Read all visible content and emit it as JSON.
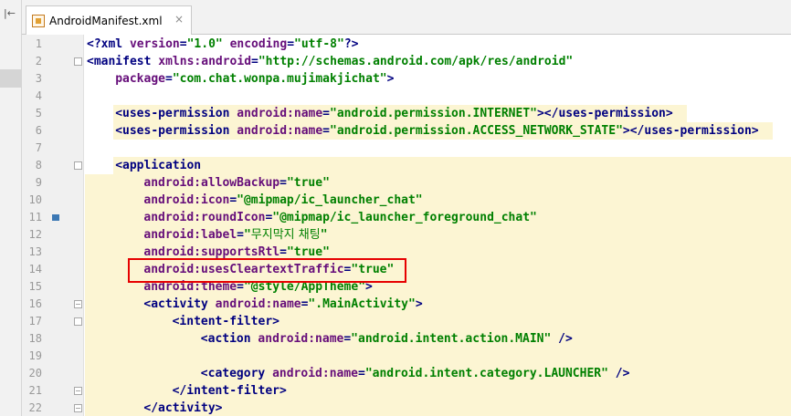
{
  "tab": {
    "label": "AndroidManifest.xml",
    "close": "×"
  },
  "sidebar": {
    "collapse_glyph": "|←"
  },
  "lines": [
    {
      "n": "1",
      "indent": 0,
      "parts": [
        [
          "t",
          "<?xml "
        ],
        [
          "a",
          "version"
        ],
        [
          "t",
          "="
        ],
        [
          "v",
          "\"1.0\""
        ],
        [
          "t",
          " "
        ],
        [
          "a",
          "encoding"
        ],
        [
          "t",
          "="
        ],
        [
          "v",
          "\"utf-8\""
        ],
        [
          "t",
          "?>"
        ]
      ]
    },
    {
      "n": "2",
      "indent": 0,
      "parts": [
        [
          "t",
          "<manifest "
        ],
        [
          "a",
          "xmlns:android"
        ],
        [
          "t",
          "="
        ],
        [
          "v",
          "\"http://schemas.android.com/apk/res/android\""
        ]
      ]
    },
    {
      "n": "3",
      "indent": 1,
      "parts": [
        [
          "a",
          "package"
        ],
        [
          "t",
          "="
        ],
        [
          "v",
          "\"com.chat.wonpa.mujimakjichat\""
        ],
        [
          "t",
          ">"
        ]
      ]
    },
    {
      "n": "4",
      "indent": 0,
      "parts": []
    },
    {
      "n": "5",
      "indent": 1,
      "parts": [
        [
          "t",
          "<uses-permission "
        ],
        [
          "a",
          "android:name"
        ],
        [
          "t",
          "="
        ],
        [
          "v",
          "\"android.permission.INTERNET\""
        ],
        [
          "t",
          "></uses-permission>"
        ]
      ]
    },
    {
      "n": "6",
      "indent": 1,
      "parts": [
        [
          "t",
          "<uses-permission "
        ],
        [
          "a",
          "android:name"
        ],
        [
          "t",
          "="
        ],
        [
          "v",
          "\"android.permission.ACCESS_NETWORK_STATE\""
        ],
        [
          "t",
          "></uses-permission>"
        ]
      ]
    },
    {
      "n": "7",
      "indent": 0,
      "parts": []
    },
    {
      "n": "8",
      "indent": 1,
      "parts": [
        [
          "t",
          "<application"
        ]
      ]
    },
    {
      "n": "9",
      "indent": 2,
      "parts": [
        [
          "a",
          "android:allowBackup"
        ],
        [
          "t",
          "="
        ],
        [
          "v",
          "\"true\""
        ]
      ]
    },
    {
      "n": "10",
      "indent": 2,
      "parts": [
        [
          "a",
          "android:icon"
        ],
        [
          "t",
          "="
        ],
        [
          "v",
          "\"@mipmap/ic_launcher_chat\""
        ]
      ]
    },
    {
      "n": "11",
      "indent": 2,
      "parts": [
        [
          "a",
          "android:roundIcon"
        ],
        [
          "t",
          "="
        ],
        [
          "v",
          "\"@mipmap/ic_launcher_foreground_chat\""
        ]
      ]
    },
    {
      "n": "12",
      "indent": 2,
      "parts": [
        [
          "a",
          "android:label"
        ],
        [
          "t",
          "="
        ],
        [
          "v",
          "\""
        ],
        [
          "kr",
          "무지막지 채팅"
        ],
        [
          "v",
          "\""
        ]
      ]
    },
    {
      "n": "13",
      "indent": 2,
      "parts": [
        [
          "a",
          "android:supportsRtl"
        ],
        [
          "t",
          "="
        ],
        [
          "v",
          "\"true\""
        ]
      ]
    },
    {
      "n": "14",
      "indent": 2,
      "parts": [
        [
          "a",
          "android:usesCleartextTraffic"
        ],
        [
          "t",
          "="
        ],
        [
          "v",
          "\"true\""
        ]
      ]
    },
    {
      "n": "15",
      "indent": 2,
      "parts": [
        [
          "a",
          "android:theme"
        ],
        [
          "t",
          "="
        ],
        [
          "v",
          "\"@style/AppTheme\""
        ],
        [
          "t",
          ">"
        ]
      ]
    },
    {
      "n": "16",
      "indent": 2,
      "parts": [
        [
          "t",
          "<activity "
        ],
        [
          "a",
          "android:name"
        ],
        [
          "t",
          "="
        ],
        [
          "v",
          "\".MainActivity\""
        ],
        [
          "t",
          ">"
        ]
      ]
    },
    {
      "n": "17",
      "indent": 3,
      "parts": [
        [
          "t",
          "<intent-filter>"
        ]
      ]
    },
    {
      "n": "18",
      "indent": 4,
      "parts": [
        [
          "t",
          "<action "
        ],
        [
          "a",
          "android:name"
        ],
        [
          "t",
          "="
        ],
        [
          "v",
          "\"android.intent.action.MAIN\""
        ],
        [
          "t",
          " />"
        ]
      ]
    },
    {
      "n": "19",
      "indent": 0,
      "parts": []
    },
    {
      "n": "20",
      "indent": 4,
      "parts": [
        [
          "t",
          "<category "
        ],
        [
          "a",
          "android:name"
        ],
        [
          "t",
          "="
        ],
        [
          "v",
          "\"android.intent.category.LAUNCHER\""
        ],
        [
          "t",
          " />"
        ]
      ]
    },
    {
      "n": "21",
      "indent": 3,
      "parts": [
        [
          "t",
          "</intent-filter>"
        ]
      ]
    },
    {
      "n": "22",
      "indent": 2,
      "parts": [
        [
          "t",
          "</activity>"
        ]
      ]
    }
  ],
  "colors": {
    "tag": "#000080",
    "attribute": "#660e7a",
    "value": "#008000",
    "highlight": "#fcf5d3",
    "callout": "#e60000"
  },
  "icons": {
    "bookmark_line": "11",
    "bulb_line": "15"
  }
}
